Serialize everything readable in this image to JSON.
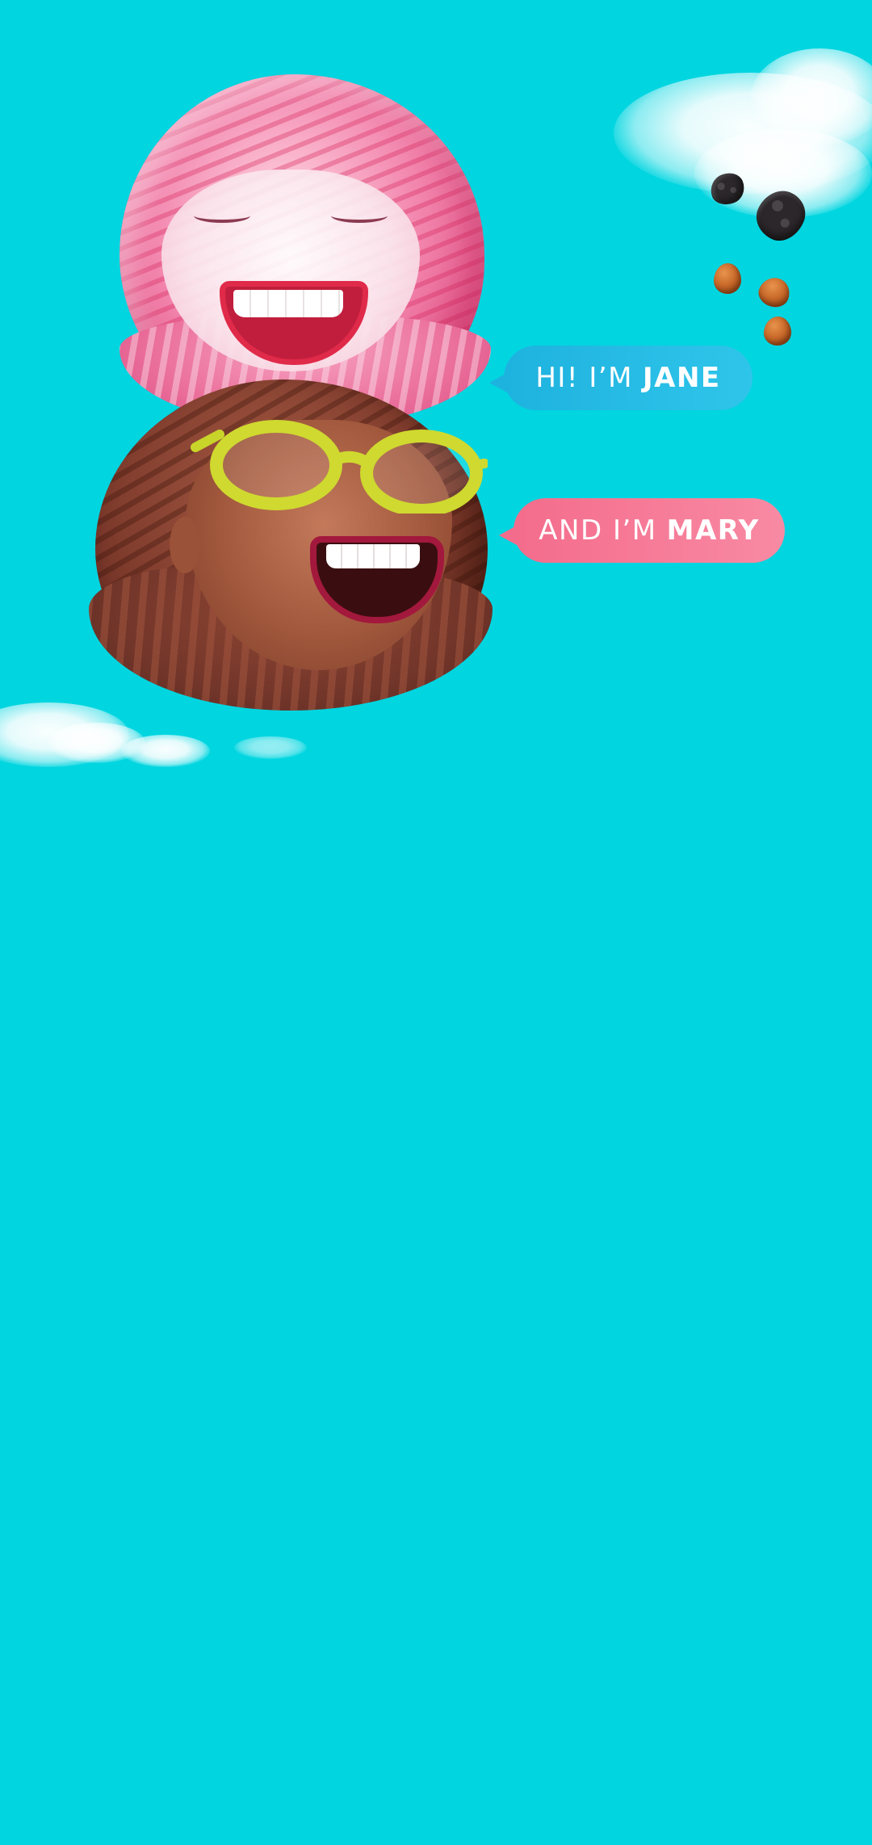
{
  "theme": {
    "background": "#00d5e0",
    "jane_bubble_color": "#1eb2df",
    "mary_bubble_color": "#f46c8c"
  },
  "bubbles": {
    "jane": {
      "prefix": "HI! I’M",
      "name": "JANE"
    },
    "mary": {
      "prefix": "AND I’M",
      "name": "MARY"
    }
  },
  "decorations": {
    "top_icons": [
      "cloud-icon",
      "cookie-icon",
      "cookie-icon",
      "hazelnut-icon",
      "hazelnut-icon",
      "hazelnut-icon"
    ],
    "bottom_icons": [
      "cloud-icon"
    ]
  }
}
